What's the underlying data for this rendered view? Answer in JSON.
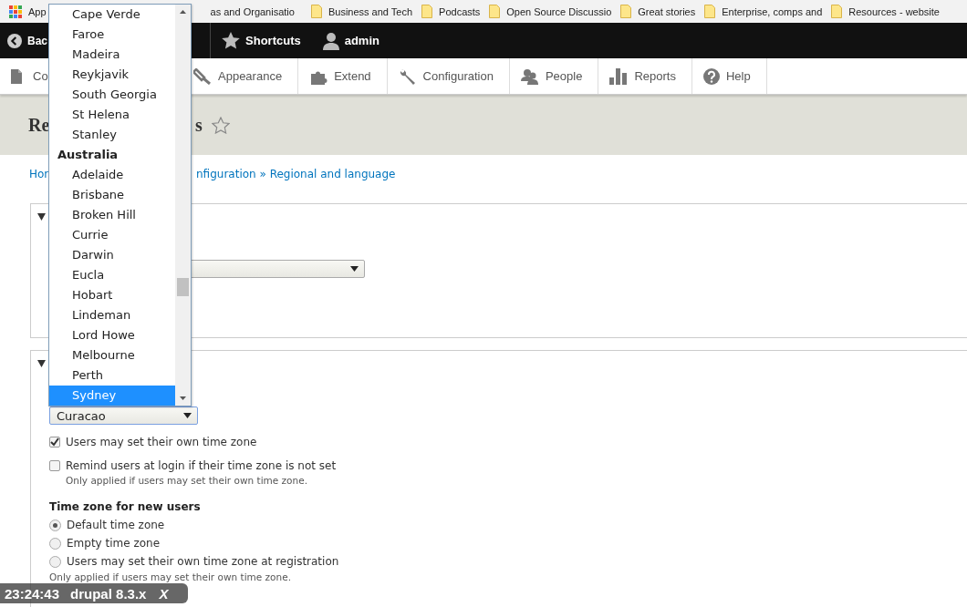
{
  "bookmarks_bar": {
    "apps_label": "App",
    "items": [
      {
        "label": "as and Organisatio"
      },
      {
        "label": "Business and Tech"
      },
      {
        "label": "Podcasts"
      },
      {
        "label": "Open Source Discussio"
      },
      {
        "label": "Great stories"
      },
      {
        "label": "Enterprise, comps and"
      },
      {
        "label": "Resources - website"
      }
    ]
  },
  "toolbar": {
    "back_label": "Bac",
    "items": [
      {
        "label": "Shortcuts"
      },
      {
        "label": "admin"
      }
    ]
  },
  "admin_menu": {
    "first_label": "Co",
    "items": [
      {
        "label": "Appearance"
      },
      {
        "label": "Extend"
      },
      {
        "label": "Configuration"
      },
      {
        "label": "People"
      },
      {
        "label": "Reports"
      },
      {
        "label": "Help"
      }
    ]
  },
  "page_title": {
    "start": "Re",
    "end": "s",
    "starred": false
  },
  "breadcrumb": {
    "start": "Hor",
    "end": "nfiguration » Regional and language"
  },
  "fieldsets": [
    {
      "expanded": true
    },
    {
      "expanded": true,
      "select": {
        "value": "Curacao"
      },
      "checkboxes": [
        {
          "label": "Users may set their own time zone",
          "checked": true
        },
        {
          "label": "Remind users at login if their time zone is not set",
          "checked": false,
          "description": "Only applied if users may set their own time zone."
        }
      ],
      "radio_group": {
        "title": "Time zone for new users",
        "options": [
          {
            "label": "Default time zone",
            "selected": true
          },
          {
            "label": "Empty time zone",
            "selected": false
          },
          {
            "label": "Users may set their own time zone at registration",
            "selected": false
          }
        ],
        "description": "Only applied if users may set their own time zone."
      }
    }
  ],
  "timezone_dropdown": {
    "options": [
      {
        "kind": "option",
        "label": "Cape Verde",
        "selected": false
      },
      {
        "kind": "option",
        "label": "Faroe",
        "selected": false
      },
      {
        "kind": "option",
        "label": "Madeira",
        "selected": false
      },
      {
        "kind": "option",
        "label": "Reykjavik",
        "selected": false
      },
      {
        "kind": "option",
        "label": "South Georgia",
        "selected": false
      },
      {
        "kind": "option",
        "label": "St Helena",
        "selected": false
      },
      {
        "kind": "option",
        "label": "Stanley",
        "selected": false
      },
      {
        "kind": "group",
        "label": "Australia"
      },
      {
        "kind": "option",
        "label": "Adelaide",
        "selected": false
      },
      {
        "kind": "option",
        "label": "Brisbane",
        "selected": false
      },
      {
        "kind": "option",
        "label": "Broken Hill",
        "selected": false
      },
      {
        "kind": "option",
        "label": "Currie",
        "selected": false
      },
      {
        "kind": "option",
        "label": "Darwin",
        "selected": false
      },
      {
        "kind": "option",
        "label": "Eucla",
        "selected": false
      },
      {
        "kind": "option",
        "label": "Hobart",
        "selected": false
      },
      {
        "kind": "option",
        "label": "Lindeman",
        "selected": false
      },
      {
        "kind": "option",
        "label": "Lord Howe",
        "selected": false
      },
      {
        "kind": "option",
        "label": "Melbourne",
        "selected": false
      },
      {
        "kind": "option",
        "label": "Perth",
        "selected": false
      },
      {
        "kind": "option",
        "label": "Sydney",
        "selected": true
      }
    ]
  },
  "overlay_badge": {
    "time": "23:24:43",
    "label": "drupal 8.3.x",
    "close": "X"
  }
}
